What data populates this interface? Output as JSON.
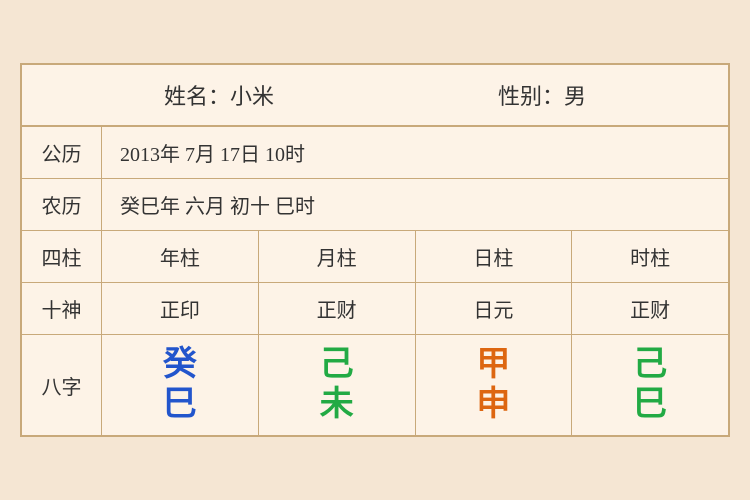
{
  "header": {
    "name_label": "姓名：小米",
    "gender_label": "性别：男"
  },
  "rows": {
    "solar_label": "公历",
    "solar_value": "2013年 7月 17日 10时",
    "lunar_label": "农历",
    "lunar_value": "癸巳年 六月 初十 巳时",
    "sizhu_label": "四柱",
    "sizhu_cols": [
      "年柱",
      "月柱",
      "日柱",
      "时柱"
    ],
    "shishen_label": "十神",
    "shishen_cols": [
      "正印",
      "正财",
      "日元",
      "正财"
    ],
    "bazhi_label": "八字",
    "bazhi_cols": [
      {
        "top": "癸",
        "bot": "巳",
        "top_color": "blue",
        "bot_color": "blue"
      },
      {
        "top": "己",
        "bot": "未",
        "top_color": "green",
        "bot_color": "green"
      },
      {
        "top": "甲",
        "bot": "申",
        "top_color": "orange",
        "bot_color": "orange"
      },
      {
        "top": "己",
        "bot": "巳",
        "top_color": "green2",
        "bot_color": "green2"
      }
    ]
  }
}
